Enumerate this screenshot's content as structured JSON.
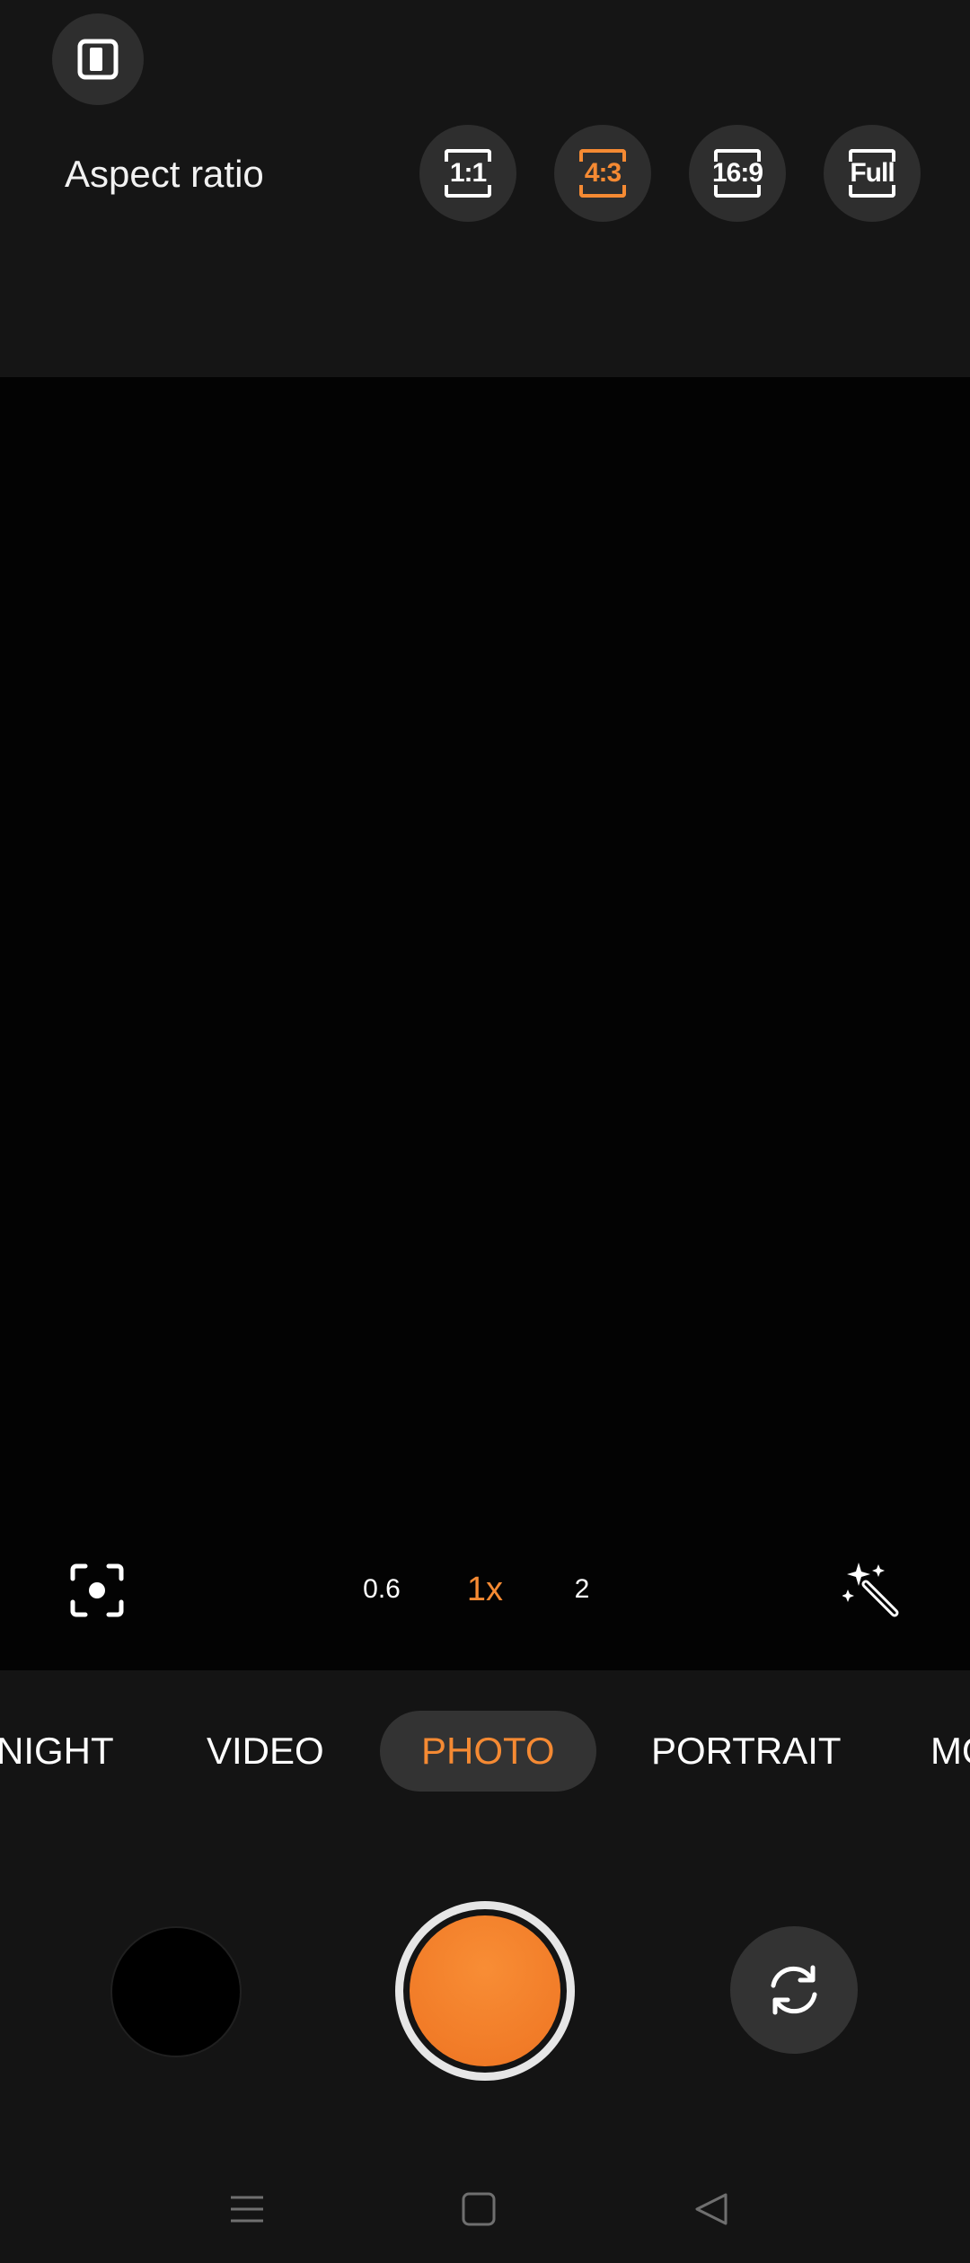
{
  "top_panel": {
    "aspect_label": "Aspect ratio",
    "ratios": [
      {
        "label": "1:1",
        "selected": false
      },
      {
        "label": "4:3",
        "selected": true
      },
      {
        "label": "16:9",
        "selected": false
      },
      {
        "label": "Full",
        "selected": false
      }
    ]
  },
  "zoom": {
    "options": [
      "0.6",
      "1x",
      "2"
    ],
    "selected": "1x"
  },
  "modes": {
    "items": [
      "NIGHT",
      "VIDEO",
      "PHOTO",
      "PORTRAIT",
      "MO"
    ],
    "selected": "PHOTO"
  },
  "icons": {
    "layout_toggle": "split-layout-icon",
    "scan": "lens-scan-icon",
    "magic": "magic-wand-icon",
    "flip": "camera-flip-icon",
    "nav_menu": "menu-icon",
    "nav_home": "home-icon",
    "nav_back": "back-icon"
  },
  "colors": {
    "accent": "#f58a33",
    "background": "#141414",
    "viewfinder": "#030303",
    "chip": "#2e2e2e"
  }
}
